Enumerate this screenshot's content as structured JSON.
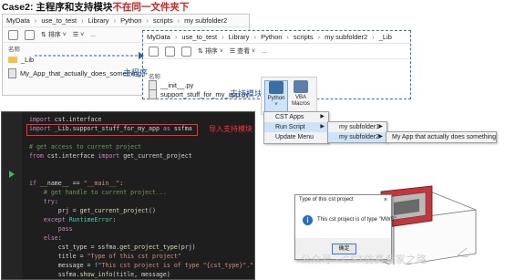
{
  "title": {
    "prefix": "Case2: 主程序和支持模块",
    "highlight": "不在同一文件夹下"
  },
  "explorer1": {
    "breadcrumb": [
      "MyData",
      "use_to_test",
      "Library",
      "Python",
      "scripts",
      "my subfolder2"
    ],
    "toolbar": {
      "sort_label": "排序",
      "more_label": "..."
    },
    "column_header": "名称",
    "items": [
      {
        "name": "_Lib",
        "type": "folder"
      },
      {
        "name": "My_App_that_actually_does_something.py",
        "type": "file"
      }
    ],
    "main_label": "主程序"
  },
  "explorer2": {
    "breadcrumb": [
      "MyData",
      "use_to_test",
      "Library",
      "Python",
      "scripts",
      "my subfolder2",
      "_Lib"
    ],
    "toolbar": {
      "sort_label": "排序",
      "view_label": "查看",
      "more_label": "..."
    },
    "column_header": "名称",
    "items": [
      {
        "name": "__init__.py"
      },
      {
        "name": "support_stuff_for_my_app.py"
      }
    ],
    "support_label": "支持模块"
  },
  "ribbon": {
    "python_label": "Python",
    "vba_label": "VBA Macros"
  },
  "menu": {
    "items": [
      "CST Apps",
      "Run Script",
      "Update Menu"
    ],
    "submenu1": [
      "my subfolder1",
      "my subfolder2"
    ],
    "submenu2": [
      "My App that actually does something"
    ]
  },
  "code": {
    "lines": [
      [
        [
          "kw",
          "import "
        ],
        [
          "nm",
          "cst.interface"
        ]
      ],
      [
        [
          "kw",
          "import "
        ],
        [
          "nm",
          "_Lib.support_stuff_for_my_app "
        ],
        [
          "kw",
          "as "
        ],
        [
          "nm",
          "ssfma"
        ]
      ],
      [],
      [
        [
          "cm",
          "# get access to current project"
        ]
      ],
      [
        [
          "kw",
          "from "
        ],
        [
          "nm",
          "cst.interface "
        ],
        [
          "kw",
          "import "
        ],
        [
          "nm",
          "get_current_project"
        ]
      ],
      [],
      [],
      [
        [
          "kw",
          "if "
        ],
        [
          "nm",
          "__name__ == "
        ],
        [
          "str",
          "\"__main__\""
        ],
        [
          "nm",
          ":"
        ]
      ],
      [
        [
          "nm",
          "    "
        ],
        [
          "cm",
          "# get handle to current project..."
        ]
      ],
      [
        [
          "nm",
          "    "
        ],
        [
          "kw",
          "try"
        ],
        [
          "nm",
          ":"
        ]
      ],
      [
        [
          "nm",
          "        prj = "
        ],
        [
          "fn",
          "get_current_project"
        ],
        [
          "nm",
          "()"
        ]
      ],
      [
        [
          "nm",
          "    "
        ],
        [
          "kw",
          "except "
        ],
        [
          "ex",
          "RuntimeError"
        ],
        [
          "nm",
          ":"
        ]
      ],
      [
        [
          "nm",
          "        "
        ],
        [
          "kw",
          "pass"
        ]
      ],
      [
        [
          "nm",
          "    "
        ],
        [
          "kw",
          "else"
        ],
        [
          "nm",
          ":"
        ]
      ],
      [
        [
          "nm",
          "        cst_type = ssfma."
        ],
        [
          "fn",
          "get_project_type"
        ],
        [
          "nm",
          "(prj)"
        ]
      ],
      [
        [
          "nm",
          "        title = "
        ],
        [
          "str",
          "\"Type of this cst project\""
        ]
      ],
      [
        [
          "nm",
          "        message = "
        ],
        [
          "def",
          "f"
        ],
        [
          "str",
          "\"This cst project is of type \"{cst_type}\".\""
        ]
      ],
      [
        [
          "nm",
          "        ssfma."
        ],
        [
          "fn",
          "show_info"
        ],
        [
          "nm",
          "(title, message)"
        ]
      ]
    ],
    "import_annotation": "导入支持模块"
  },
  "dialog": {
    "title": "Type of this cst project",
    "close": "×",
    "message": "This cst project is of type \"MWS\".",
    "ok_label": "确定"
  },
  "watermark": "公众号 · CST仿真专家之路",
  "colors": {
    "accent_red": "#e21b1b",
    "accent_blue": "#1e56b5",
    "code_bg": "#1e1e1e"
  }
}
